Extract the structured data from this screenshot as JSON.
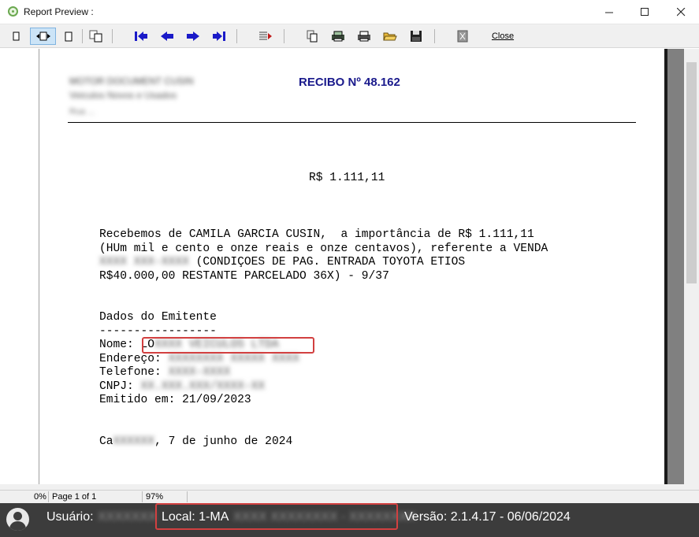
{
  "window": {
    "title": "Report Preview :"
  },
  "toolbar": {
    "close_label": "Close"
  },
  "report": {
    "company_name": "MOTOR DOCUMENT CUSIN",
    "company_subtitle": "Veiculos Novos e Usados",
    "company_line3": "Rua ...",
    "title": "RECIBO Nº 48.162",
    "amount": "R$ 1.111,11",
    "body_line1": "Recebemos de CAMILA GARCIA CUSIN,  a importância de R$ 1.111,11",
    "body_line2": "(HUm mil e cento e onze reais e onze centavos), referente a VENDA",
    "body_line3_redacted": "XXXX XXX-XXXX",
    "body_line3_rest": " (CONDIÇOES DE PAG. ENTRADA TOYOTA ETIOS",
    "body_line4": "R$40.000,00 RESTANTE PARCELADO 36X) - 9/37",
    "emitter_heading": "Dados do Emitente",
    "emitter_rule": "-----------------",
    "nome_label": "Nome: ",
    "nome_value_visible": "LO",
    "nome_value_redacted": "XXXX VEICULOS LTDA",
    "endereco_label": "Endereço: ",
    "endereco_redacted": "XXXXXXXX XXXXX XXXX",
    "telefone_label": "Telefone: ",
    "telefone_redacted": "XXXX-XXXX",
    "cnpj_label": "CNPJ: ",
    "cnpj_redacted": "XX.XXX.XXX/XXXX-XX",
    "emitido_label": "Emitido em: ",
    "emitido_value": "21/09/2023",
    "city_visible": "Ca",
    "city_redacted": "XXXXXX",
    "date_text": ", 7 de junho de 2024"
  },
  "status": {
    "progress": "0%",
    "page": "Page 1 of 1",
    "zoom": "97%"
  },
  "footer": {
    "user_label": "Usuário:",
    "user_redacted": "XXXXXXX",
    "local_label": "Local: 1-MA",
    "local_redacted": "XXXX XXXXXXXX - XXXXXXXX",
    "version": "Versão: 2.1.4.17 - 06/06/2024"
  }
}
